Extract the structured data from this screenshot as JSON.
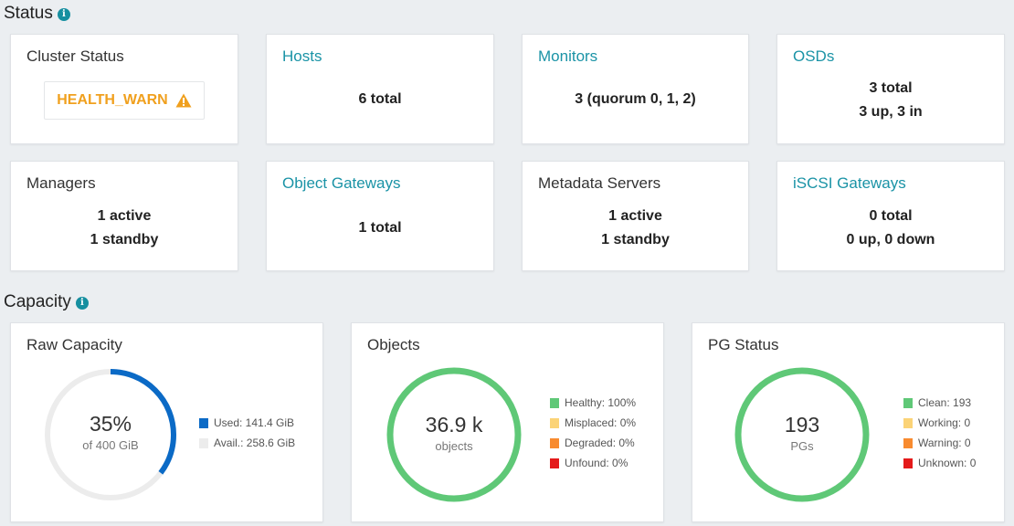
{
  "status_section": {
    "title": "Status",
    "info_icon": "info-icon"
  },
  "capacity_section": {
    "title": "Capacity",
    "info_icon": "info-icon"
  },
  "cluster_status": {
    "title": "Cluster Status",
    "health": "HEALTH_WARN",
    "health_icon": "warning-icon",
    "health_color": "#f0a01e"
  },
  "hosts": {
    "title": "Hosts",
    "line1": "6 total"
  },
  "monitors": {
    "title": "Monitors",
    "line1": "3 (quorum 0, 1, 2)"
  },
  "osds": {
    "title": "OSDs",
    "line1": "3 total",
    "line2": "3 up, 3 in"
  },
  "managers": {
    "title": "Managers",
    "line1": "1 active",
    "line2": "1 standby"
  },
  "object_gateways": {
    "title": "Object Gateways",
    "line1": "1 total"
  },
  "metadata_servers": {
    "title": "Metadata Servers",
    "line1": "1 active",
    "line2": "1 standby"
  },
  "iscsi_gateways": {
    "title": "iSCSI Gateways",
    "line1": "0 total",
    "line2": "0 up, 0 down"
  },
  "raw_capacity": {
    "title": "Raw Capacity",
    "percent_label": "35%",
    "sub_label": "of 400 GiB",
    "used_fraction": 0.3535,
    "legend": [
      {
        "label": "Used: 141.4 GiB",
        "color": "#0b6ac6"
      },
      {
        "label": "Avail.: 258.6 GiB",
        "color": "#ececec"
      }
    ]
  },
  "objects": {
    "title": "Objects",
    "center_value": "36.9 k",
    "center_label": "objects",
    "ring_color": "#5fc877",
    "legend": [
      {
        "label": "Healthy: 100%",
        "color": "#5fc877"
      },
      {
        "label": "Misplaced: 0%",
        "color": "#fbd377"
      },
      {
        "label": "Degraded: 0%",
        "color": "#f88b2f"
      },
      {
        "label": "Unfound: 0%",
        "color": "#e41a1a"
      }
    ]
  },
  "pg_status": {
    "title": "PG Status",
    "center_value": "193",
    "center_label": "PGs",
    "ring_color": "#5fc877",
    "legend": [
      {
        "label": "Clean: 193",
        "color": "#5fc877"
      },
      {
        "label": "Working: 0",
        "color": "#fbd377"
      },
      {
        "label": "Warning: 0",
        "color": "#f88b2f"
      },
      {
        "label": "Unknown: 0",
        "color": "#e41a1a"
      }
    ]
  }
}
